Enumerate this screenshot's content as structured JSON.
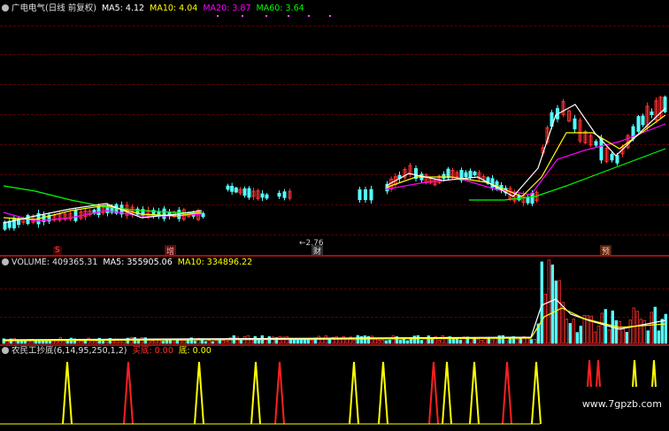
{
  "header": {
    "stock_name": "广电电气(日线 前复权)",
    "ma5_label": "MA5: 4.12",
    "ma10_label": "MA10: 4.04",
    "ma20_label": "MA20: 3.87",
    "ma60_label": "MA60: 3.64"
  },
  "price_pane": {
    "low_marker": "←2.76",
    "event_markers": [
      "S",
      "增",
      "财",
      "预"
    ]
  },
  "volume_pane": {
    "volume_label": "VOLUME: 409365.31",
    "ma5_label": "MA5: 355905.06",
    "ma10_label": "MA10: 334896.22"
  },
  "indicator_pane": {
    "name_label": "农民工抄底(6,14,95,250,1,2)",
    "buy_label": "买底: 0.00",
    "bottom_label": "底: 0.00"
  },
  "watermark": "www.7gpzb.com",
  "colors": {
    "ma5": "#ffffff",
    "ma10": "#ffff00",
    "ma20": "#ff00ff",
    "ma60": "#00ff00",
    "up": "#ff3232",
    "down": "#54ffff",
    "buy_signal": "#ff2020",
    "bottom_signal": "#ffff00"
  }
}
